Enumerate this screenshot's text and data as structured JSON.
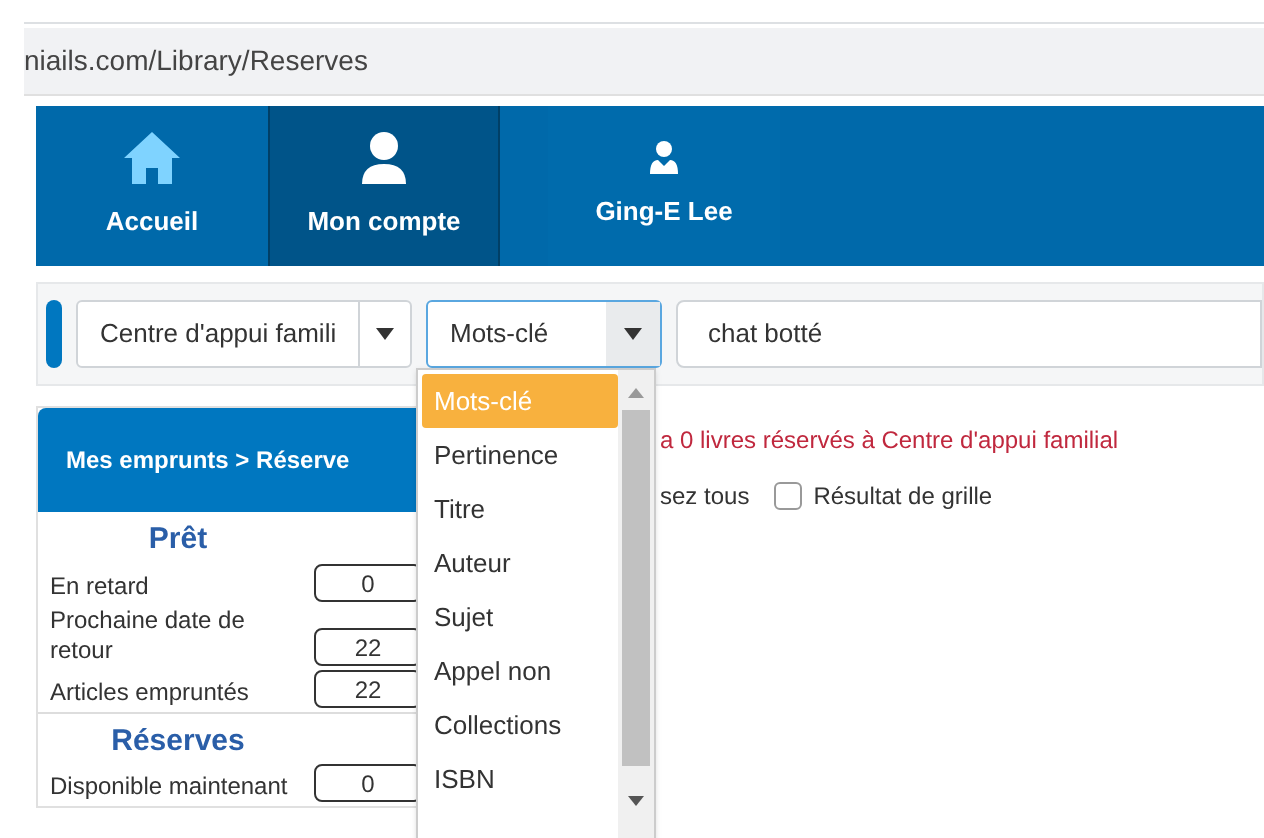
{
  "address_bar": {
    "url": "niails.com/Library/Reserves"
  },
  "nav": {
    "tabs": [
      {
        "label": "Accueil",
        "kind": "home",
        "selected": false
      },
      {
        "label": "Mon compte",
        "kind": "account",
        "selected": true
      },
      {
        "label": "Ging-E Lee",
        "kind": "profile",
        "selected": false
      }
    ]
  },
  "search": {
    "branch": "Centre d'appui famili",
    "field": "Mots-clé",
    "query": "chat botté"
  },
  "field_menu": {
    "items": [
      {
        "label": "Mots-clé",
        "selected": true
      },
      {
        "label": "Pertinence",
        "selected": false
      },
      {
        "label": "Titre",
        "selected": false
      },
      {
        "label": "Auteur",
        "selected": false
      },
      {
        "label": "Sujet",
        "selected": false
      },
      {
        "label": "Appel non",
        "selected": false
      },
      {
        "label": "Collections",
        "selected": false
      },
      {
        "label": "ISBN",
        "selected": false
      }
    ]
  },
  "sidebar": {
    "title": "Mes emprunts > Réserve",
    "sections": [
      {
        "heading": "Prêt",
        "rows": [
          {
            "label": "En retard",
            "value": "0"
          },
          {
            "label": "Prochaine date de retour",
            "value": "22"
          },
          {
            "label": "Articles empruntés",
            "value": "22"
          }
        ]
      },
      {
        "heading": "Réserves",
        "rows": [
          {
            "label": "Disponible maintenant",
            "value": "0"
          }
        ]
      }
    ]
  },
  "content": {
    "message": "a 0 livres réservés à Centre d'appui familial",
    "select_all": "sez tous",
    "grid_result": {
      "label": "Résultat de grille",
      "checked": false
    }
  }
}
